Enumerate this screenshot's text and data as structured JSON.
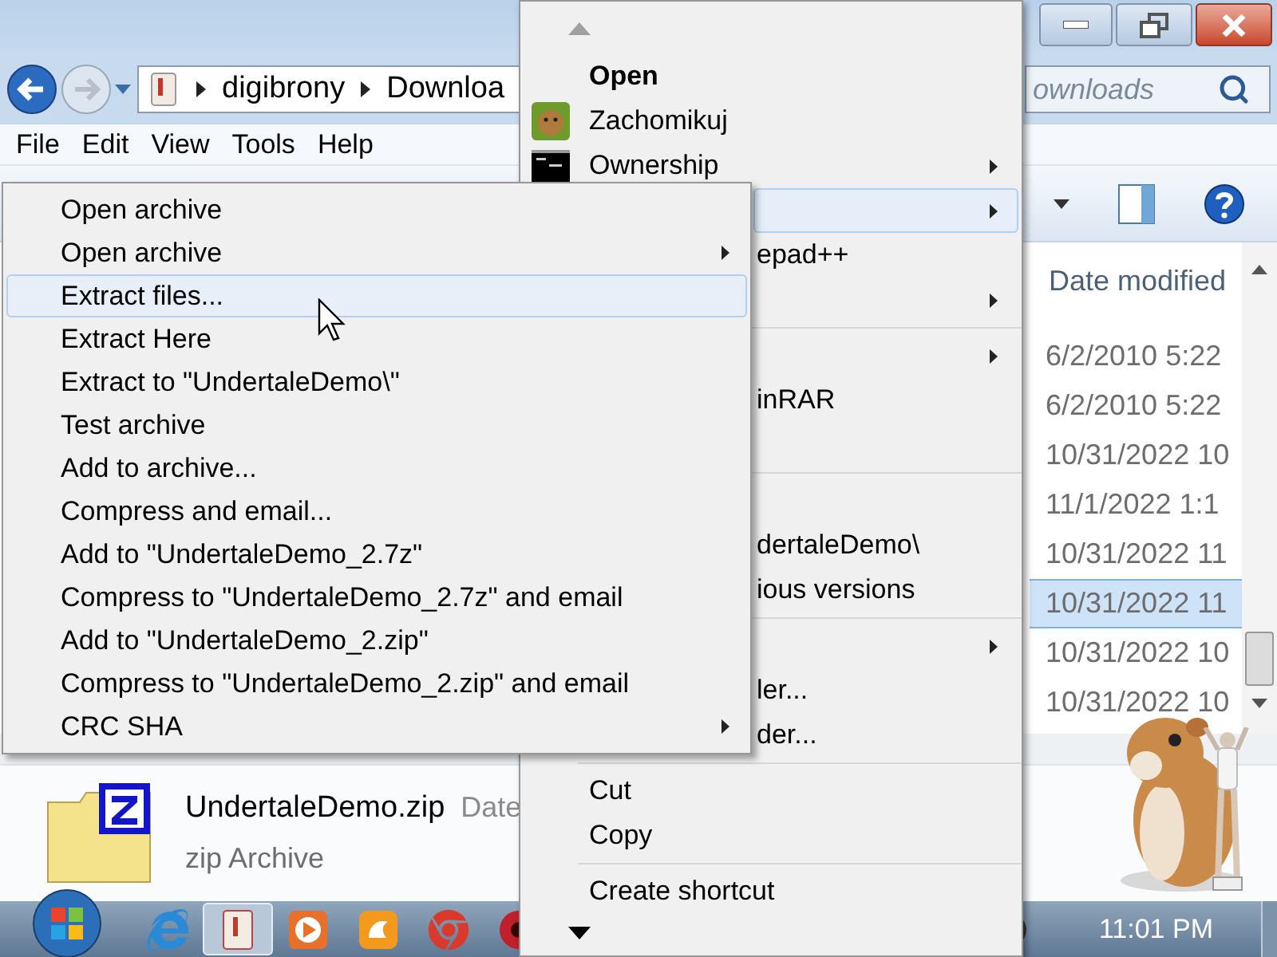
{
  "explorer": {
    "breadcrumb": [
      "digibrony",
      "Downloa"
    ],
    "search": {
      "placeholder": "ownloads"
    },
    "menu_bar": [
      "File",
      "Edit",
      "View",
      "Tools",
      "Help"
    ],
    "file_list": {
      "columns": [
        "Date modified"
      ],
      "rows": [
        {
          "date_modified": "6/2/2010 5:22",
          "selected": false
        },
        {
          "date_modified": "6/2/2010 5:22",
          "selected": false
        },
        {
          "date_modified": "10/31/2022 10",
          "selected": false
        },
        {
          "date_modified": "11/1/2022 1:1",
          "selected": false
        },
        {
          "date_modified": "10/31/2022 11",
          "selected": false
        },
        {
          "date_modified": "10/31/2022 11",
          "selected": true
        },
        {
          "date_modified": "10/31/2022 10",
          "selected": false
        },
        {
          "date_modified": "10/31/2022 10",
          "selected": false
        }
      ]
    },
    "details": {
      "name": "UndertaleDemo.zip",
      "field_label": "Date",
      "type": "zip Archive"
    }
  },
  "context_menu": {
    "items": [
      {
        "kind": "item",
        "label": "Open",
        "default": true,
        "submenu": false,
        "highlighted": false
      },
      {
        "kind": "item",
        "label": "Zachomikuj",
        "default": false,
        "submenu": false,
        "highlighted": false
      },
      {
        "kind": "item",
        "label": "Ownership",
        "default": false,
        "submenu": true,
        "highlighted": false
      },
      {
        "kind": "covered",
        "submenu": true,
        "highlighted": true
      },
      {
        "kind": "covered",
        "label": "epad++",
        "submenu": false,
        "highlighted": false
      },
      {
        "kind": "covered",
        "submenu": true,
        "highlighted": false
      },
      {
        "kind": "separator"
      },
      {
        "kind": "covered",
        "submenu": true,
        "highlighted": false
      },
      {
        "kind": "covered",
        "label": "inRAR",
        "submenu": false,
        "highlighted": false
      },
      {
        "kind": "covered"
      },
      {
        "kind": "separator"
      },
      {
        "kind": "covered"
      },
      {
        "kind": "covered",
        "label": "dertaleDemo\\",
        "submenu": false,
        "highlighted": false
      },
      {
        "kind": "covered",
        "label": "ious versions",
        "submenu": false,
        "highlighted": false
      },
      {
        "kind": "separator"
      },
      {
        "kind": "covered",
        "submenu": true,
        "highlighted": false
      },
      {
        "kind": "covered",
        "label": "ler...",
        "submenu": false,
        "highlighted": false
      },
      {
        "kind": "covered",
        "label": "der...",
        "submenu": false,
        "highlighted": false
      },
      {
        "kind": "separator"
      },
      {
        "kind": "item",
        "label": "Cut",
        "default": false,
        "submenu": false,
        "highlighted": false
      },
      {
        "kind": "item",
        "label": "Copy",
        "default": false,
        "submenu": false,
        "highlighted": false
      },
      {
        "kind": "separator"
      },
      {
        "kind": "item",
        "label": "Create shortcut",
        "default": false,
        "submenu": false,
        "highlighted": false
      }
    ]
  },
  "submenu": {
    "items": [
      {
        "label": "Open archive",
        "submenu": false,
        "highlighted": false
      },
      {
        "label": "Open archive",
        "submenu": true,
        "highlighted": false
      },
      {
        "label": "Extract files...",
        "submenu": false,
        "highlighted": true
      },
      {
        "label": "Extract Here",
        "submenu": false,
        "highlighted": false
      },
      {
        "label": "Extract to \"UndertaleDemo\\\"",
        "submenu": false,
        "highlighted": false
      },
      {
        "label": "Test archive",
        "submenu": false,
        "highlighted": false
      },
      {
        "label": "Add to archive...",
        "submenu": false,
        "highlighted": false
      },
      {
        "label": "Compress and email...",
        "submenu": false,
        "highlighted": false
      },
      {
        "label": "Add to \"UndertaleDemo_2.7z\"",
        "submenu": false,
        "highlighted": false
      },
      {
        "label": "Compress to \"UndertaleDemo_2.7z\" and email",
        "submenu": false,
        "highlighted": false
      },
      {
        "label": "Add to \"UndertaleDemo_2.zip\"",
        "submenu": false,
        "highlighted": false
      },
      {
        "label": "Compress to \"UndertaleDemo_2.zip\" and email",
        "submenu": false,
        "highlighted": false
      },
      {
        "label": "CRC SHA",
        "submenu": true,
        "highlighted": false
      }
    ]
  },
  "taskbar": {
    "apps": [
      {
        "kind": "ie",
        "active": false
      },
      {
        "kind": "explorer",
        "active": true
      },
      {
        "kind": "media",
        "active": false
      },
      {
        "kind": "uc",
        "active": false
      },
      {
        "kind": "chrome",
        "active": false
      },
      {
        "kind": "red",
        "active": false
      }
    ],
    "clock": "11:01 PM"
  }
}
